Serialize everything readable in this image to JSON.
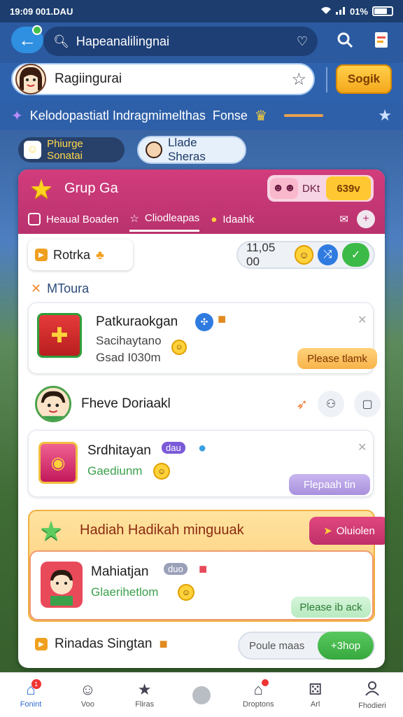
{
  "status": {
    "time": "19:09 001.DAU",
    "signal": "01%"
  },
  "header": {
    "search_text": "Hapeanalilingnai",
    "profile_name": "Ragiingurai",
    "action_button": "Sogik"
  },
  "ticker": {
    "text": "Kelodopastiatl Indragmimelthas",
    "extra": "Fonse"
  },
  "chips": [
    {
      "label": "Phiurge Sonatai"
    },
    {
      "label": "Llade Sheras"
    }
  ],
  "group": {
    "title": "Grup Ga",
    "badge_label": "DKt",
    "badge_value": "639v",
    "tabs": [
      {
        "label": "Heaual Boaden"
      },
      {
        "label": "Cliodleapas"
      },
      {
        "label": "Idaahk"
      }
    ]
  },
  "top_row": {
    "label": "Rotrka",
    "score": "11,05 00"
  },
  "section_label": "MToura",
  "items": [
    {
      "title": "Patkuraokgan",
      "subtitle": "Sacihaytano",
      "meta": "Gsad I030m",
      "button": "Please tlamk"
    },
    {
      "title": "Fheve Doriaakl"
    },
    {
      "title": "Srdhitayan",
      "tag": "dau",
      "subtitle": "Gaediunm",
      "button": "Flepaah tin"
    }
  ],
  "promo": {
    "title": "Hadiah Hadikah minguuak",
    "button": "Oluiolen",
    "card": {
      "title": "Mahiatjan",
      "tag": "duo",
      "subtitle": "Glaerihetlom",
      "button": "Please ib ack"
    }
  },
  "bottom_row": {
    "label": "Rinadas Singtan",
    "pill_label": "Poule maas",
    "pill_button": "+3hop"
  },
  "nav": [
    {
      "label": "Fonint",
      "icon": "home-icon",
      "badge": "1"
    },
    {
      "label": "Voo",
      "icon": "smile-icon"
    },
    {
      "label": "Fliras",
      "icon": "star-icon"
    },
    {
      "label": "",
      "icon": "dot-icon"
    },
    {
      "label": "Droptons",
      "icon": "house-icon"
    },
    {
      "label": "Arl",
      "icon": "dice-icon"
    },
    {
      "label": "Fhodieri",
      "icon": "user-icon"
    }
  ]
}
